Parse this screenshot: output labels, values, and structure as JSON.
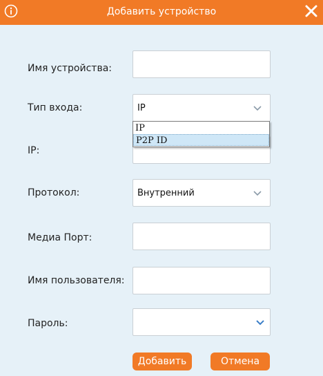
{
  "dialog": {
    "title": "Добавить устройство",
    "accent_color": "#f17a26",
    "background_color": "#e6f1f8"
  },
  "icons": {
    "info": "info-icon",
    "close": "close-icon",
    "chevron": "chevron-down-icon"
  },
  "form": {
    "device_name_label": "Имя устройства:",
    "device_name_value": "",
    "login_type_label": "Тип входа:",
    "login_type_value": "IP",
    "login_type_options": [
      "IP",
      "P2P ID"
    ],
    "ip_label": "IP:",
    "ip_value": "",
    "protocol_label": "Протокол:",
    "protocol_value": "Внутренний",
    "media_port_label": "Медиа Порт:",
    "media_port_value": "",
    "username_label": "Имя пользователя:",
    "username_value": "",
    "password_label": "Пароль:",
    "password_value": ""
  },
  "buttons": {
    "add": "Добавить",
    "cancel": "Отмена"
  }
}
